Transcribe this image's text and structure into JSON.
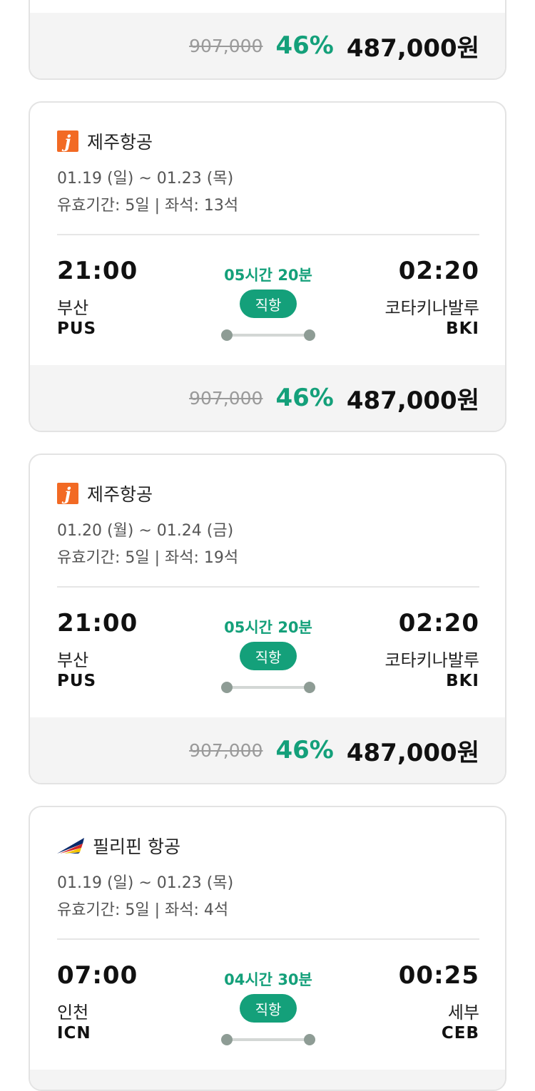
{
  "top_card": {
    "original_price": "907,000",
    "discount": "46%",
    "final_price": "487,000원"
  },
  "cards": [
    {
      "airline": "제주항공",
      "logo_icon": "jeju-air-logo-icon",
      "dates": "01.19 (일) ~ 01.23 (목)",
      "validity": "유효기간: 5일 | 좌석: 13석",
      "departure_time": "21:00",
      "departure_city": "부산",
      "departure_code": "PUS",
      "arrival_time": "02:20",
      "arrival_city": "코타키나발루",
      "arrival_code": "BKI",
      "duration": "05시간 20분",
      "flight_type": "직항",
      "original_price": "907,000",
      "discount": "46%",
      "final_price": "487,000원"
    },
    {
      "airline": "제주항공",
      "logo_icon": "jeju-air-logo-icon",
      "dates": "01.20 (월) ~ 01.24 (금)",
      "validity": "유효기간: 5일 | 좌석: 19석",
      "departure_time": "21:00",
      "departure_city": "부산",
      "departure_code": "PUS",
      "arrival_time": "02:20",
      "arrival_city": "코타키나발루",
      "arrival_code": "BKI",
      "duration": "05시간 20분",
      "flight_type": "직항",
      "original_price": "907,000",
      "discount": "46%",
      "final_price": "487,000원"
    },
    {
      "airline": "필리핀 항공",
      "logo_icon": "philippine-airlines-logo-icon",
      "dates": "01.19 (일) ~ 01.23 (목)",
      "validity": "유효기간: 5일 | 좌석: 4석",
      "departure_time": "07:00",
      "departure_city": "인천",
      "departure_code": "ICN",
      "arrival_time": "00:25",
      "arrival_city": "세부",
      "arrival_code": "CEB",
      "duration": "04시간 30분",
      "flight_type": "직항"
    }
  ],
  "colors": {
    "accent_green": "#14a07a",
    "jeju_orange": "#f26a24",
    "price_bar_bg": "#f4f4f4"
  }
}
